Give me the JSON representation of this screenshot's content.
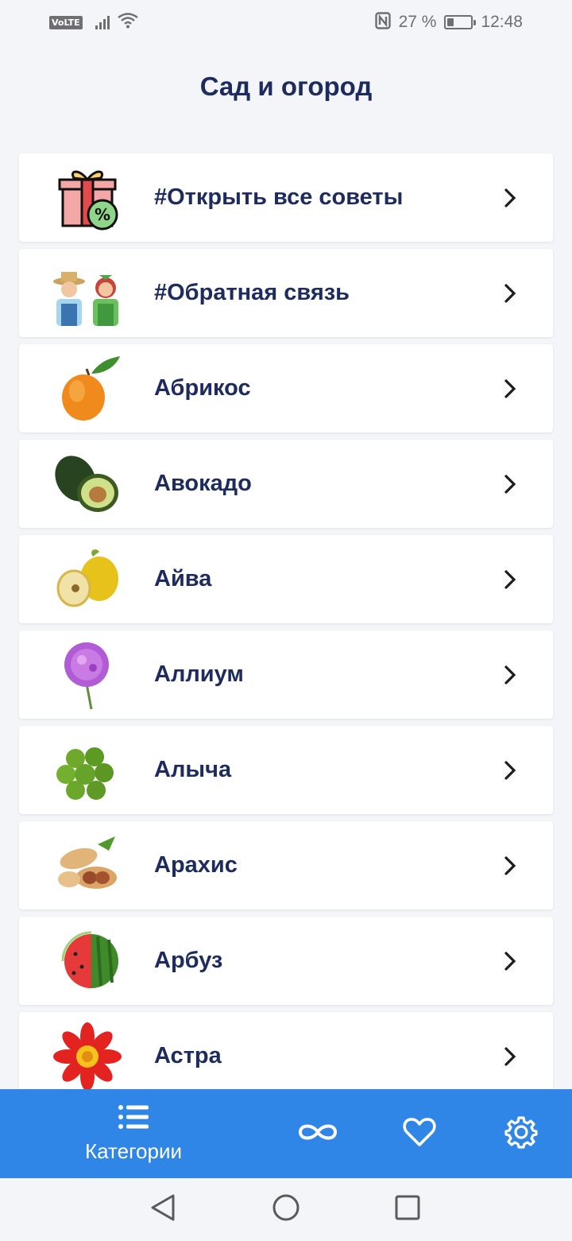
{
  "status_bar": {
    "network_badge": "VoLTE",
    "battery_text": "27 %",
    "battery_level": 0.27,
    "time": "12:48",
    "icons": [
      "volte-icon",
      "signal-icon",
      "wifi-icon",
      "nfc-icon",
      "battery-icon"
    ]
  },
  "header": {
    "title": "Сад и огород"
  },
  "list": {
    "items": [
      {
        "label": "#Открыть все советы",
        "icon": "gift-discount-icon"
      },
      {
        "label": "#Обратная связь",
        "icon": "farmers-icon"
      },
      {
        "label": "Абрикос",
        "icon": "apricot-icon"
      },
      {
        "label": "Авокадо",
        "icon": "avocado-icon"
      },
      {
        "label": "Айва",
        "icon": "quince-icon"
      },
      {
        "label": "Аллиум",
        "icon": "allium-icon"
      },
      {
        "label": "Алыча",
        "icon": "cherry-plum-icon"
      },
      {
        "label": "Арахис",
        "icon": "peanut-icon"
      },
      {
        "label": "Арбуз",
        "icon": "watermelon-icon"
      },
      {
        "label": "Астра",
        "icon": "aster-icon"
      }
    ]
  },
  "bottom_nav": {
    "categories_label": "Категории",
    "icons": [
      "list-icon",
      "infinity-icon",
      "heart-icon",
      "gear-icon"
    ],
    "background": "#2f86e6"
  },
  "system_nav": {
    "icons": [
      "back-icon",
      "home-icon",
      "recents-icon"
    ]
  },
  "colors": {
    "background": "#f4f5f9",
    "text": "#1d2b5e",
    "accent": "#2f86e6"
  }
}
